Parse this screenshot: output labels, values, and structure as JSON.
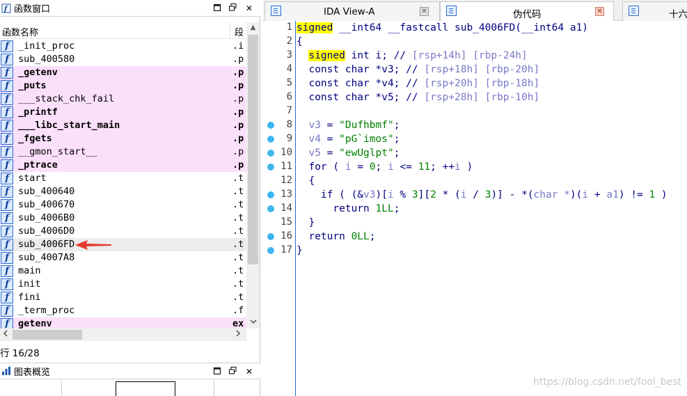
{
  "functions_window": {
    "title": "函数窗口",
    "col_name": "函数名称",
    "col_seg": "段",
    "rows": [
      {
        "name": "_init_proc",
        "seg": ".i",
        "kind": "normal"
      },
      {
        "name": "sub_400580",
        "seg": ".p",
        "kind": "normal"
      },
      {
        "name": "_getenv",
        "seg": ".p",
        "kind": "lib"
      },
      {
        "name": "_puts",
        "seg": ".p",
        "kind": "lib"
      },
      {
        "name": "___stack_chk_fail",
        "seg": ".p",
        "kind": "normal-lib"
      },
      {
        "name": "_printf",
        "seg": ".p",
        "kind": "lib"
      },
      {
        "name": "___libc_start_main",
        "seg": ".p",
        "kind": "lib"
      },
      {
        "name": "_fgets",
        "seg": ".p",
        "kind": "lib"
      },
      {
        "name": "__gmon_start__",
        "seg": ".p",
        "kind": "normal-lib"
      },
      {
        "name": "_ptrace",
        "seg": ".p",
        "kind": "lib"
      },
      {
        "name": "start",
        "seg": ".t",
        "kind": "normal"
      },
      {
        "name": "sub_400640",
        "seg": ".t",
        "kind": "normal"
      },
      {
        "name": "sub_400670",
        "seg": ".t",
        "kind": "normal"
      },
      {
        "name": "sub_4006B0",
        "seg": ".t",
        "kind": "normal"
      },
      {
        "name": "sub_4006D0",
        "seg": ".t",
        "kind": "normal"
      },
      {
        "name": "sub_4006FD",
        "seg": ".t",
        "kind": "sel"
      },
      {
        "name": "sub_4007A8",
        "seg": ".t",
        "kind": "normal"
      },
      {
        "name": "main",
        "seg": ".t",
        "kind": "normal"
      },
      {
        "name": "init",
        "seg": ".t",
        "kind": "normal"
      },
      {
        "name": "fini",
        "seg": ".t",
        "kind": "normal"
      },
      {
        "name": "_term_proc",
        "seg": ".f",
        "kind": "normal"
      },
      {
        "name": "getenv",
        "seg": "ex",
        "kind": "lib"
      }
    ],
    "icon_glyph": "f",
    "status": "行 16/28"
  },
  "graph_overview": {
    "title": "图表概览"
  },
  "tabs": [
    {
      "label": "IDA View-A"
    },
    {
      "label": "伪代码"
    },
    {
      "label": "十六"
    }
  ],
  "code_lines": [
    {
      "n": "1",
      "dot": false
    },
    {
      "n": "2",
      "dot": false
    },
    {
      "n": "3",
      "dot": false
    },
    {
      "n": "4",
      "dot": false
    },
    {
      "n": "5",
      "dot": false
    },
    {
      "n": "6",
      "dot": false
    },
    {
      "n": "7",
      "dot": false
    },
    {
      "n": "8",
      "dot": true
    },
    {
      "n": "9",
      "dot": true
    },
    {
      "n": "10",
      "dot": true
    },
    {
      "n": "11",
      "dot": true
    },
    {
      "n": "12",
      "dot": false
    },
    {
      "n": "13",
      "dot": true
    },
    {
      "n": "14",
      "dot": true
    },
    {
      "n": "15",
      "dot": false
    },
    {
      "n": "16",
      "dot": true
    },
    {
      "n": "17",
      "dot": true
    }
  ],
  "code": {
    "l1_kw": "signed",
    "l1_rest": " __int64 __fastcall sub_4006FD(__int64 a1)",
    "l2": "{",
    "l3_kw": "signed",
    "l3_rest": " int i; // ",
    "l3_cmt": "[rsp+14h] [rbp-24h]",
    "l4": "const char *v3; // ",
    "l4_cmt": "[rsp+18h] [rbp-20h]",
    "l5": "const char *v4; // ",
    "l5_cmt": "[rsp+20h] [rbp-18h]",
    "l6": "const char *v5; // ",
    "l6_cmt": "[rsp+28h] [rbp-10h]",
    "l8_a": "v3",
    "l8_b": " = ",
    "l8_s": "\"Dufhbmf\"",
    "l8_e": ";",
    "l9_a": "v4",
    "l9_b": " = ",
    "l9_s": "\"pG`imos\"",
    "l9_e": ";",
    "l10_a": "v5",
    "l10_b": " = ",
    "l10_s": "\"ewUglpt\"",
    "l10_e": ";",
    "l11_a": "for ( ",
    "l11_b": "i",
    "l11_c": " = ",
    "l11_d": "0",
    "l11_e": "; ",
    "l11_f": "i",
    "l11_g": " <= ",
    "l11_h": "11",
    "l11_i": "; ++",
    "l11_j": "i",
    "l11_k": " )",
    "l12": "{",
    "l13_a": "if ( (&",
    "l13_b": "v3",
    "l13_c": ")[",
    "l13_d": "i",
    "l13_e": " % ",
    "l13_f": "3",
    "l13_g": "][",
    "l13_h": "2",
    "l13_i": " * (",
    "l13_j": "i",
    "l13_k": " / ",
    "l13_l": "3",
    "l13_m": ")] - *(",
    "l13_n": "char *",
    "l13_o": ")(",
    "l13_p": "i",
    "l13_q": " + ",
    "l13_r": "a1",
    "l13_s": ") != ",
    "l13_t": "1",
    "l13_u": " )",
    "l14_a": "return ",
    "l14_b": "1LL",
    "l14_c": ";",
    "l15": "}",
    "l16_a": "return ",
    "l16_b": "0LL",
    "l16_c": ";",
    "l17": "}"
  },
  "watermark": "https://blog.csdn.net/fool_best"
}
